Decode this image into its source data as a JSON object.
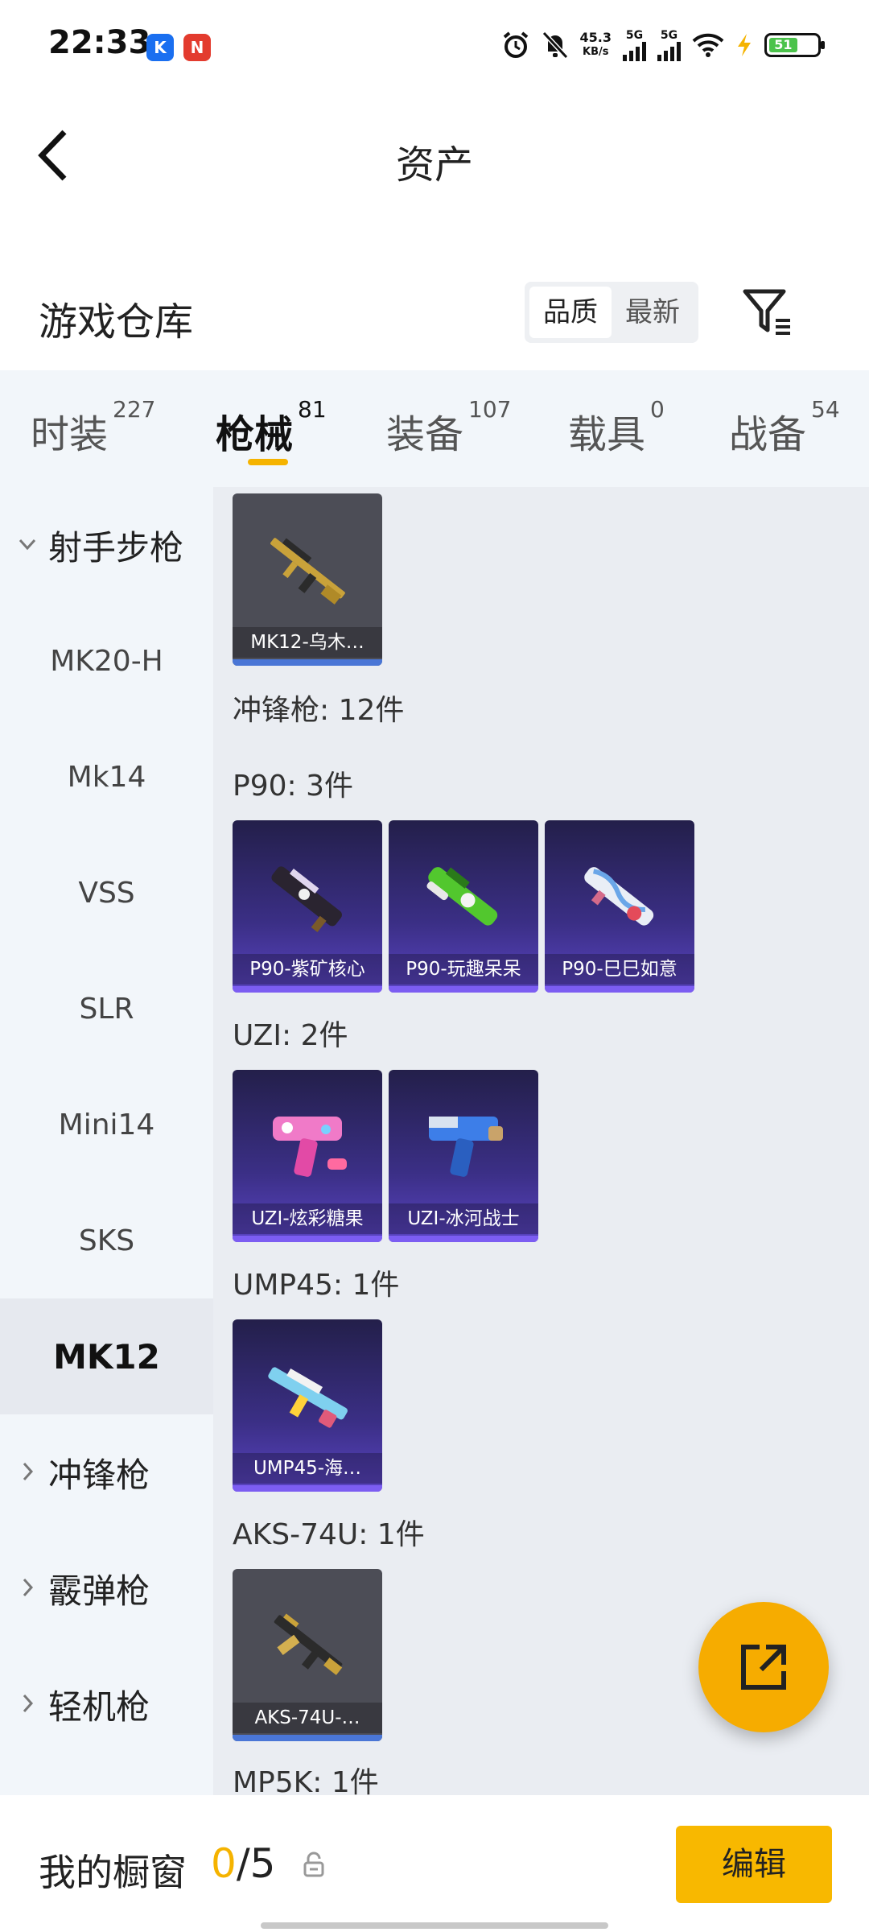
{
  "status_bar": {
    "time": "22:33",
    "app_badges": [
      "K",
      "N"
    ],
    "net_speed_value": "45.3",
    "net_speed_unit": "KB/s",
    "signal_1": "5G",
    "signal_2": "5G",
    "battery": "51"
  },
  "header": {
    "title": "资产"
  },
  "warehouse": {
    "title": "游戏仓库",
    "sort_options": [
      "品质",
      "最新"
    ],
    "active_sort": "品质"
  },
  "tabs": [
    {
      "label": "时装",
      "count": "227"
    },
    {
      "label": "枪械",
      "count": "81"
    },
    {
      "label": "装备",
      "count": "107"
    },
    {
      "label": "载具",
      "count": "0"
    },
    {
      "label": "战备",
      "count": "54"
    }
  ],
  "side_nav": [
    {
      "label": "射手步枪",
      "type": "group-open"
    },
    {
      "label": "MK20-H",
      "type": "item"
    },
    {
      "label": "Mk14",
      "type": "item"
    },
    {
      "label": "VSS",
      "type": "item"
    },
    {
      "label": "SLR",
      "type": "item"
    },
    {
      "label": "Mini14",
      "type": "item"
    },
    {
      "label": "SKS",
      "type": "item"
    },
    {
      "label": "MK12",
      "type": "item-selected"
    },
    {
      "label": "冲锋枪",
      "type": "group-closed"
    },
    {
      "label": "霰弹枪",
      "type": "group-closed"
    },
    {
      "label": "轻机枪",
      "type": "group-closed"
    }
  ],
  "content": {
    "labels": {
      "smg_total": "冲锋枪: 12件",
      "p90": "P90: 3件",
      "uzi": "UZI: 2件",
      "ump45": "UMP45: 1件",
      "aks74u": "AKS-74U: 1件",
      "mp5k": "MP5K: 1件"
    },
    "cards": {
      "mk12": "MK12-乌木…",
      "p90_1": "P90-紫矿核心",
      "p90_2": "P90-玩趣呆呆",
      "p90_3": "P90-巳巳如意",
      "uzi_1": "UZI-炫彩糖果",
      "uzi_2": "UZI-冰河战士",
      "ump45_1": "UMP45-海…",
      "aks74u_1": "AKS-74U-…"
    }
  },
  "bottom_bar": {
    "label": "我的橱窗",
    "count_current": "0",
    "count_total": "/5",
    "edit_label": "编辑"
  },
  "colors": {
    "accent": "#f5b300",
    "fab": "#f6ac00",
    "nav_bg": "#f2f6fa",
    "content_bg": "#eaedf2"
  },
  "icons": [
    "back-arrow-icon",
    "filter-icon",
    "chevron-down-icon",
    "chevron-right-icon",
    "share-icon",
    "lock-icon"
  ]
}
